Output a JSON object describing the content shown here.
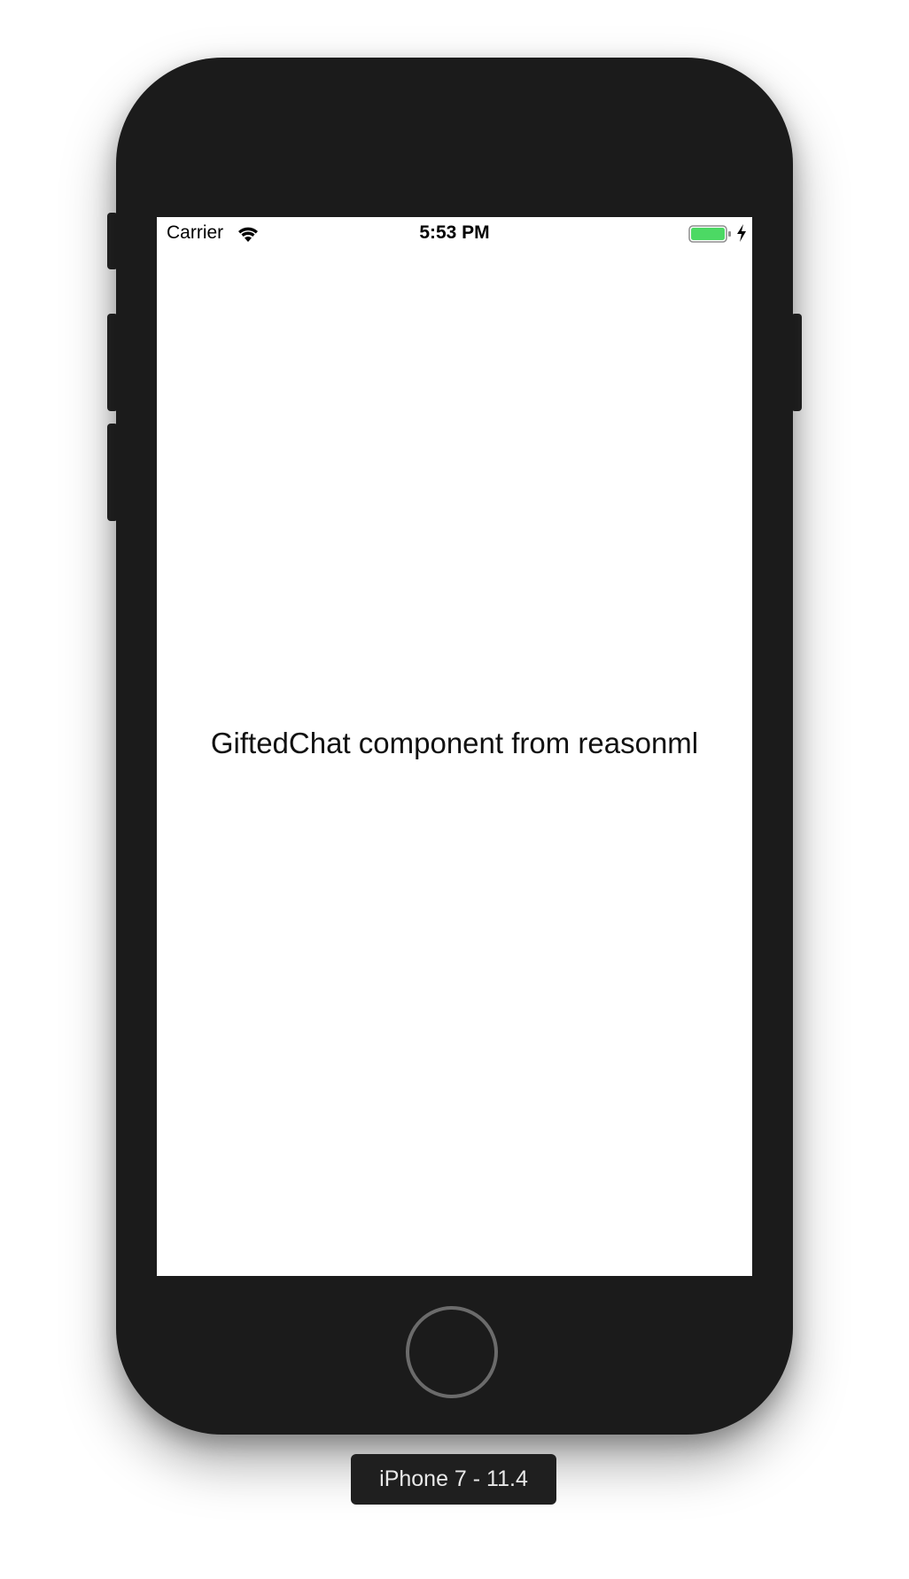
{
  "status_bar": {
    "carrier": "Carrier",
    "time": "5:53 PM",
    "wifi_icon": "wifi-icon",
    "battery_icon": "battery-icon",
    "charging_icon": "charging-bolt-icon",
    "battery_level": 1.0,
    "battery_color": "#4cd964"
  },
  "content": {
    "label": "GiftedChat component from reasonml"
  },
  "device": {
    "label": "iPhone 7 - 11.4",
    "body_color": "#1b1b1b"
  }
}
